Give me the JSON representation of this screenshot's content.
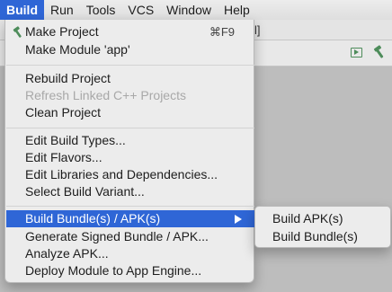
{
  "menubar": {
    "items": [
      "Build",
      "Run",
      "Tools",
      "VCS",
      "Window",
      "Help"
    ],
    "active_index": 0
  },
  "ide": {
    "toolbar_hint": "l]",
    "run_icon": "run-config-icon",
    "build_icon": "hammer-icon"
  },
  "build_menu": {
    "make_project": "Make Project",
    "make_project_shortcut": "⌘F9",
    "make_module": "Make Module 'app'",
    "rebuild_project": "Rebuild Project",
    "refresh_linked": "Refresh Linked C++ Projects",
    "clean_project": "Clean Project",
    "edit_build_types": "Edit Build Types...",
    "edit_flavors": "Edit Flavors...",
    "edit_libraries": "Edit Libraries and Dependencies...",
    "select_build_variant": "Select Build Variant...",
    "build_bundles": "Build Bundle(s) / APK(s)",
    "generate_signed": "Generate Signed Bundle / APK...",
    "analyze_apk": "Analyze APK...",
    "deploy_module": "Deploy Module to App Engine..."
  },
  "submenu": {
    "build_apk": "Build APK(s)",
    "build_bundle": "Build Bundle(s)"
  },
  "colors": {
    "highlight": "#2f66d6",
    "hammer": "#4d8c5a"
  }
}
